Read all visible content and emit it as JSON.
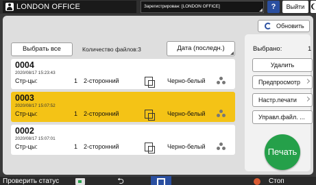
{
  "topbar": {
    "office_name": "LONDON OFFICE",
    "login_status": "Зарегистрирован: [LONDON OFFICE]",
    "help_label": "?",
    "logout_label": "Выйти"
  },
  "list": {
    "select_all_label": "Выбрать все",
    "file_count_text": "Количество файлов:3",
    "sort_label": "Дата (последн.)",
    "pages_label": "Стр-цы:",
    "files": [
      {
        "name": "0004",
        "date": "2020/08/17 15:23:43",
        "pages": "1",
        "sides": "2-сторонний",
        "color_mode": "Черно-белый",
        "selected": false
      },
      {
        "name": "0003",
        "date": "2020/08/17 15:07:52",
        "pages": "1",
        "sides": "2-сторонний",
        "color_mode": "Черно-белый",
        "selected": true
      },
      {
        "name": "0002",
        "date": "2020/08/17 15:07:01",
        "pages": "1",
        "sides": "2-сторонний",
        "color_mode": "Черно-белый",
        "selected": false
      }
    ]
  },
  "side": {
    "refresh_label": "Обновить",
    "selected_label": "Выбрано:",
    "selected_count": "1",
    "delete_label": "Удалить",
    "preview_label": "Предпросмотр",
    "print_settings_label": "Настр.печати",
    "file_management_label": "Управл.файл. ...",
    "print_label": "Печать"
  },
  "bottombar": {
    "check_status_label": "Проверить статус",
    "back_symbol": "⮌",
    "stop_label": "Стоп"
  },
  "colors": {
    "selected_row": "#f4c316",
    "print_button": "#25a04a",
    "accent_blue": "#2a4fa0"
  }
}
